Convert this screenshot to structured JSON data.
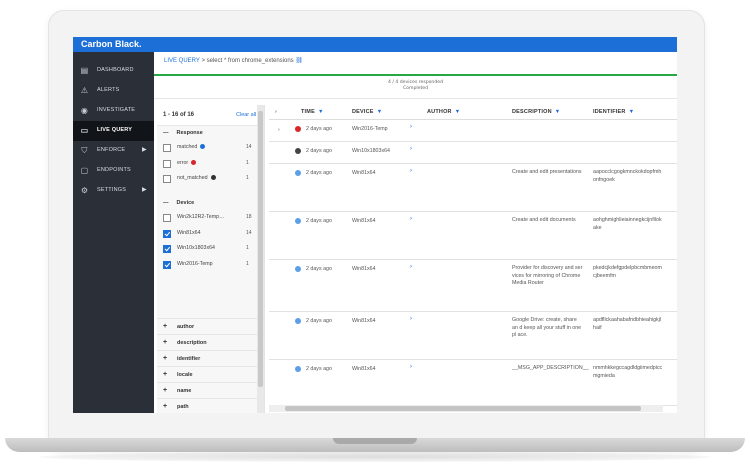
{
  "brand": "Carbon Black.",
  "sidebar": {
    "items": [
      {
        "label": "DASHBOARD",
        "icon": "dashboard-icon",
        "glyph": "▤",
        "active": false,
        "caret": false
      },
      {
        "label": "ALERTS",
        "icon": "alert-triangle-icon",
        "glyph": "⚠",
        "active": false,
        "caret": false
      },
      {
        "label": "INVESTIGATE",
        "icon": "radar-icon",
        "glyph": "◉",
        "active": false,
        "caret": false
      },
      {
        "label": "LIVE QUERY",
        "icon": "terminal-icon",
        "glyph": "▭",
        "active": true,
        "caret": false
      },
      {
        "label": "ENFORCE",
        "icon": "shield-icon",
        "glyph": "⛉",
        "active": false,
        "caret": true
      },
      {
        "label": "ENDPOINTS",
        "icon": "monitor-icon",
        "glyph": "▢",
        "active": false,
        "caret": false
      },
      {
        "label": "SETTINGS",
        "icon": "gear-icon",
        "glyph": "⚙",
        "active": false,
        "caret": true
      }
    ]
  },
  "breadcrumb": {
    "link": "LIVE QUERY",
    "rest": " > select * from chrome_extensions",
    "icon": "link-icon"
  },
  "status": {
    "line1": "4 / 4 devices responded",
    "line2": "Completed",
    "progress": 1.0
  },
  "filters": {
    "count": "1 - 16 of 16",
    "clear": "Clear all",
    "response": {
      "title": "Response",
      "rows": [
        {
          "label": "matched",
          "num": "14",
          "checked": false,
          "dot": "#1d6fd8"
        },
        {
          "label": "error",
          "num": "1",
          "checked": false,
          "dot": "#d9262a"
        },
        {
          "label": "not_matched",
          "num": "1",
          "checked": false,
          "dot": "#333333"
        }
      ]
    },
    "device": {
      "title": "Device",
      "rows": [
        {
          "label": "Win2k12R2-Temp…",
          "num": "18",
          "checked": false
        },
        {
          "label": "Win81x64",
          "num": "14",
          "checked": true
        },
        {
          "label": "Win10x1803x64",
          "num": "1",
          "checked": true
        },
        {
          "label": "Win2016-Temp",
          "num": "1",
          "checked": true
        }
      ]
    },
    "facets": [
      "author",
      "description",
      "identifier",
      "locale",
      "name",
      "path",
      "persistent",
      "uid"
    ]
  },
  "table": {
    "columns": [
      "TIME",
      "DEVICE",
      "AUTHOR",
      "DESCRIPTION",
      "IDENTIFIER"
    ],
    "rows": [
      {
        "status": "error",
        "dot": "#d9262a",
        "time": "2 days ago",
        "device": "Win2016-Temp",
        "description": "",
        "identifier": "",
        "expand": true
      },
      {
        "status": "not_matched",
        "dot": "#444444",
        "time": "2 days ago",
        "device": "Win10x1803x64",
        "description": "",
        "identifier": "",
        "expand": false
      },
      {
        "status": "matched",
        "dot": "#5aa0e6",
        "time": "2 days ago",
        "device": "Win81x64",
        "description": "Create and edit presentations",
        "identifier": "aapocclcgogkmnckokdopfmh onfngoek",
        "expand": false
      },
      {
        "status": "matched",
        "dot": "#5aa0e6",
        "time": "2 days ago",
        "device": "Win81x64",
        "description": "Create and edit documents",
        "identifier": "aohghmighlieiainnegkcijnfilok ake",
        "expand": false
      },
      {
        "status": "matched",
        "dot": "#5aa0e6",
        "time": "2 days ago",
        "device": "Win81x64",
        "description": "Provider for discovery and ser vices for mirroring of Chrome Media Router",
        "identifier": "pkedcjkdefgpdelpbcmbmeom cjbeemfm",
        "expand": false
      },
      {
        "status": "matched",
        "dot": "#5aa0e6",
        "time": "2 days ago",
        "device": "Win81x64",
        "description": "Google Drive: create, share an d keep all your stuff in one pl ace.",
        "identifier": "apdfllckaahabafndbhieahigkjl haif",
        "expand": false
      },
      {
        "status": "matched",
        "dot": "#5aa0e6",
        "time": "2 days ago",
        "device": "Win81x64",
        "description": "__MSG_APP_DESCRIPTION__",
        "identifier": "nmmhkkegccagdldgiimedpicc mgmieda",
        "expand": false
      }
    ]
  }
}
